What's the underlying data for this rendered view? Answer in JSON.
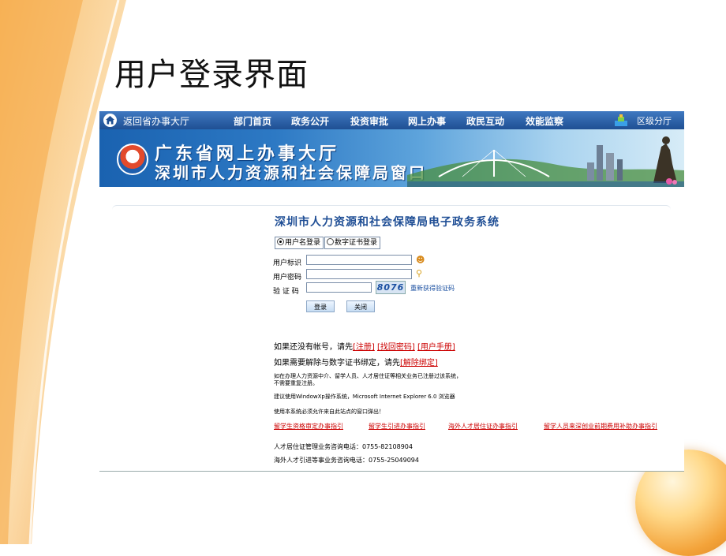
{
  "slide": {
    "title": "用户登录界面"
  },
  "nav": {
    "back_label": "返回省办事大厅",
    "items": [
      "部门首页",
      "政务公开",
      "投资审批",
      "网上办事",
      "政民互动",
      "效能监察"
    ],
    "district_label": "区级分厅"
  },
  "banner": {
    "line1": "广东省网上办事大厅",
    "line2": "深圳市人力资源和社会保障局窗口"
  },
  "login": {
    "system_title": "深圳市人力资源和社会保障局电子政务系统",
    "mode_username": "用户名登录",
    "mode_certificate": "数字证书登录",
    "selected_mode": "用户名登录",
    "username_label": "用户标识",
    "password_label": "用户密码",
    "captcha_label": "验 证 码",
    "username_value": "",
    "password_value": "",
    "captcha_value": "",
    "captcha_image_text": "8076",
    "refresh_captcha": "重新获得验证码",
    "login_button": "登录",
    "close_button": "关闭"
  },
  "info": {
    "register_prompt": "如果还没有帐号，请先",
    "register_link": "[注册]",
    "recover_link": "[找回密码]",
    "manual_link": "[用户手册]",
    "unbind_prompt": "如果需要解除与数字证书绑定，请先",
    "unbind_link": "[解除绑定]",
    "note1_line1": "如在办理人力资源中介、留学人员、人才居住证等相关业务已注册过该系统，",
    "note1_line2": "不需要重复注册。",
    "note2": "建议使用WindowXp操作系统，Microsoft Internet Explorer 6.0 浏览器",
    "note3": "使用本系统必须允许来自此站点的窗口弹出！",
    "guides": [
      "留学生资格审定办事指引",
      "留学生引进办事指引",
      "海外人才居住证办事指引",
      "留学人员来深创业前期费用补助办事指引"
    ],
    "hotline1": "人才居住证管理业务咨询电话：0755-82108904",
    "hotline2": "海外人才引进等事业务咨询电话：0755-25049094"
  },
  "colors": {
    "nav_bg": "#1f4f93",
    "banner_accent": "#2d79c4",
    "link_red": "#cc0000",
    "title_blue": "#1f4e95"
  }
}
